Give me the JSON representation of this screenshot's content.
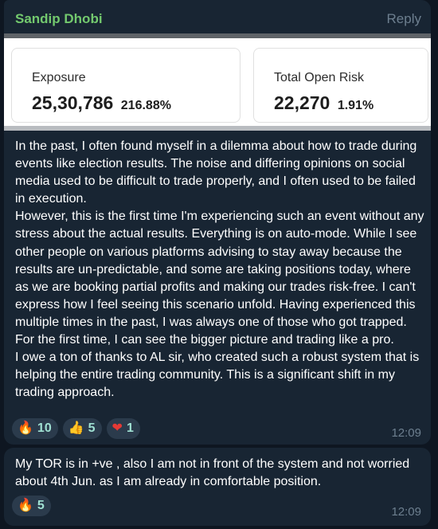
{
  "message1": {
    "sender": "Sandip Dhobi",
    "reply_label": "Reply",
    "screenshot": {
      "cards": [
        {
          "label": "Exposure",
          "value": "25,30,786",
          "percent": "216.88%"
        },
        {
          "label": "Total Open Risk",
          "value": "22,270",
          "percent": "1.91%"
        }
      ]
    },
    "text": "In the past, I often found myself in a dilemma about how to trade during events like election results. The noise and differing opinions on social media used to be difficult to trade properly, and I often used to be failed in execution.\nHowever, this is the first time I'm experiencing such an event without any stress about the actual results. Everything is on auto-mode. While I see other people on various platforms advising to stay away because the results are un-predictable, and some are taking positions today, where as we are booking partial profits and making our trades risk-free. I can't express how I feel seeing this scenario unfold. Having experienced this multiple times in the past, I was always one of those who got trapped. For the first time, I can see the bigger picture and trading like a pro.\nI owe a ton of thanks to AL sir, who created such a robust system that is helping the entire trading community. This is a significant shift in my trading approach.",
    "reactions": [
      {
        "emoji": "🔥",
        "count": "10"
      },
      {
        "emoji": "👍",
        "count": "5"
      },
      {
        "emoji": "❤",
        "count": "1"
      }
    ],
    "time": "12:09"
  },
  "message2": {
    "text": "My TOR is in +ve , also I am not in front of the system and not worried about 4th Jun. as I am already in comfortable position.",
    "reactions": [
      {
        "emoji": "🔥",
        "count": "5"
      }
    ],
    "time": "12:09"
  },
  "colors": {
    "background": "#0e1621",
    "bubble": "#182533",
    "sender": "#73c96e",
    "reaction_count": "#9fe0d2",
    "heart": "#e53935"
  }
}
